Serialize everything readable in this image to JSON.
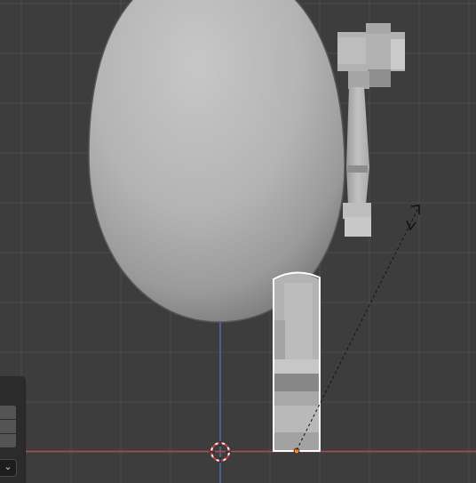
{
  "viewport": {
    "background_color": "#3d3d3d",
    "grid_color": "#4a4a4a",
    "x_axis_color": "#b04a55",
    "z_axis_color": "#4a6ea8",
    "selection_outline_color": "#ffffff",
    "origin_dot_color": "#f08a2a",
    "objects": [
      {
        "name": "egg-body",
        "type": "mesh"
      },
      {
        "name": "hammer",
        "type": "mesh"
      },
      {
        "name": "selected-object",
        "type": "mesh",
        "selected": true
      }
    ],
    "gizmos": [
      "3d-cursor-icon",
      "scale-arrow-icon"
    ]
  },
  "side_panel": {
    "dropdown_icon": "chevron-down-icon"
  }
}
